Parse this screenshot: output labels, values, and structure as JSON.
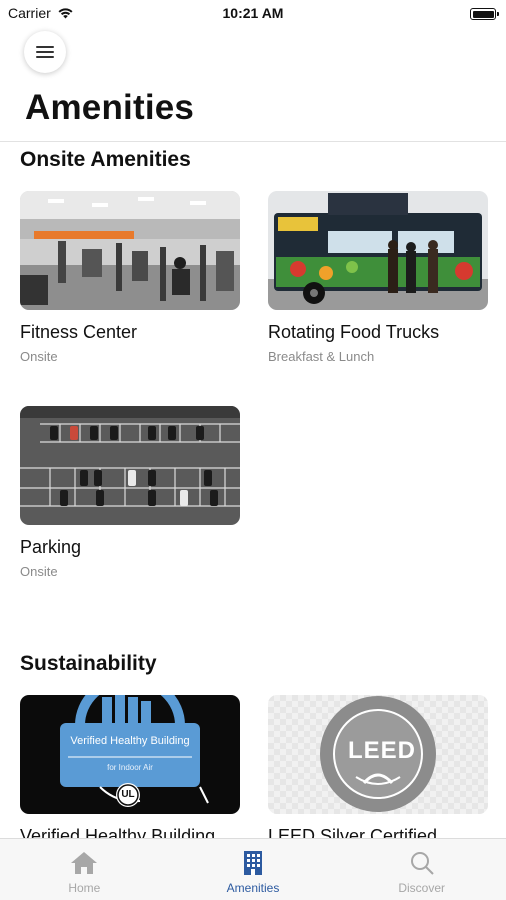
{
  "status_bar": {
    "carrier": "Carrier",
    "time": "10:21 AM"
  },
  "header": {
    "title": "Amenities"
  },
  "sections": [
    {
      "title": "Onsite Amenities",
      "cards": [
        {
          "title": "Fitness Center",
          "subtitle": "Onsite",
          "image": "gym-photo"
        },
        {
          "title": "Rotating Food Trucks",
          "subtitle": "Breakfast & Lunch",
          "image": "food-truck-photo"
        },
        {
          "title": "Parking",
          "subtitle": "Onsite",
          "image": "parking-lot-photo"
        }
      ]
    },
    {
      "title": "Sustainability",
      "cards": [
        {
          "title": "Verified Healthy Building",
          "image": "healthy-building-badge",
          "badge_text": "Verified Healthy Building",
          "badge_sub": "for Indoor Air",
          "badge_logo": "UL"
        },
        {
          "title": "LEED Silver Certified",
          "image": "leed-badge",
          "badge_text": "LEED"
        }
      ]
    }
  ],
  "tab_bar": {
    "tabs": [
      {
        "label": "Home",
        "icon": "home-icon",
        "active": false
      },
      {
        "label": "Amenities",
        "icon": "building-icon",
        "active": true
      },
      {
        "label": "Discover",
        "icon": "search-icon",
        "active": false
      }
    ]
  },
  "colors": {
    "accent": "#2c5aa0",
    "inactive": "#a7a7a7",
    "badge_blue": "#5a9bd5"
  }
}
